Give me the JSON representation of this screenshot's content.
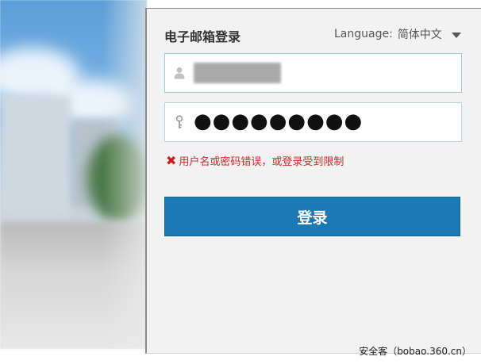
{
  "panel": {
    "title": "电子邮箱登录",
    "language_label": "Language:",
    "language_value": "简体中文"
  },
  "form": {
    "username_value": "",
    "password_mask": "●●●●●●●●●",
    "error_message": "用户名或密码错误，或登录受到限制",
    "login_label": "登录"
  },
  "watermark": "安全客（bobao.360.cn）",
  "icons": {
    "user": "user-icon",
    "key": "key-icon",
    "error": "error-x-icon",
    "caret": "caret-down-icon"
  },
  "colors": {
    "accent": "#1d79b4",
    "error": "#cc2b2b",
    "panel_bg": "#f2f2f2"
  }
}
